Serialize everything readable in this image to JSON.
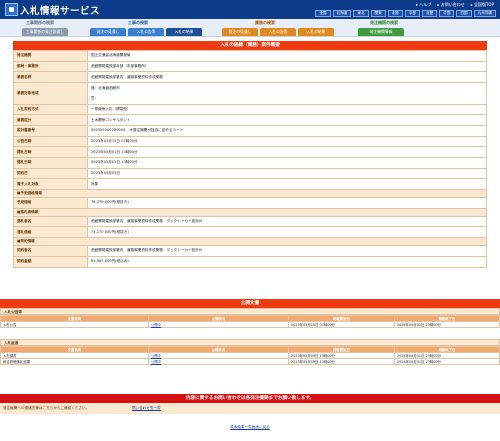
{
  "header": {
    "title": "入札情報サービス",
    "links": [
      "ヘルプ",
      "お問い合わせ",
      "全国版TOP"
    ],
    "regions": [
      "全国",
      "北海道",
      "東北",
      "関東",
      "北陸",
      "中部",
      "近畿",
      "中国",
      "四国",
      "九州沖縄"
    ]
  },
  "categories": {
    "c1": "工事関係の検索",
    "c2": "工事の検索",
    "c3": "業務の検索",
    "c4": "発注機関の検索"
  },
  "tabs": [
    {
      "label": "工事関係の発注見通し"
    },
    {
      "label": "発注の見通し"
    },
    {
      "label": "入札公告等"
    },
    {
      "label": "入札の結果"
    },
    {
      "label": "発注の見通し"
    },
    {
      "label": "入札公告等"
    },
    {
      "label": "入札の結果"
    },
    {
      "label": "発注機関情報"
    }
  ],
  "main": {
    "title": "入札の経緯（業務）案件概要",
    "rows": [
      {
        "k": "発注機関",
        "v": "国土交通省北海道開発局"
      },
      {
        "k": "部局・事務所",
        "v": "函館開発建設部本部（本部事務所）"
      },
      {
        "k": "業務名称",
        "v": "函館開発建設部管内　道路事業資料作成業務"
      },
      {
        "k": "業務対象地域",
        "v1": "渡：北海道函館市",
        "v2": "笠："
      },
      {
        "k": "入札契約方式",
        "v": "一般競争入札（標準型）"
      },
      {
        "k": "業務区分",
        "v": "土木関係コンサルタント"
      },
      {
        "k": "設計書番号",
        "v": "202325000289004",
        "note": "※発注機関が独自に定めるコード"
      },
      {
        "k": "公告日時",
        "v": "2023年03月15日 07時00分"
      },
      {
        "k": "開札日時",
        "v": "2023年05月01日 13時00分"
      },
      {
        "k": "開札日時",
        "v": "2023年05月02日 13時00分"
      },
      {
        "k": "契約日",
        "v": "2023年05月03日"
      },
      {
        "k": "電子入札対象",
        "v": "対象"
      }
    ],
    "section1": "■予定価格情報",
    "estimate": {
      "k": "予定価格",
      "v": "76,370,000円(税抜き)"
    },
    "section2": "■落札者情報",
    "winner": [
      {
        "k": "落札者名",
        "v": "函館開発建設部管内　道路事業資料作成業務　デックトーカー設計JV"
      },
      {
        "k": "落札価格",
        "v": "74,170,000円(税抜き)"
      }
    ],
    "section3": "■契約情報",
    "contract": [
      {
        "k": "契約者名",
        "v": "函館開発建設部管内　道路事業資料作成業務　デックトーカー設計JV"
      },
      {
        "k": "契約金額",
        "v": "81,587,000円(税込み)"
      }
    ]
  },
  "docs": {
    "title": "公開文書",
    "g1_title": "入札公告等",
    "headers": [
      "文書名称",
      "公開状況",
      "掲載開始日",
      "掲載終了日"
    ],
    "g1_rows": [
      {
        "name": "入札公告",
        "status": "公開中",
        "start": "2023年03月15日 07時00分",
        "end": "2024年05月31日 23時00分"
      }
    ],
    "g2_title": "入札経過",
    "g2_rows": [
      {
        "name": "入札調書",
        "status": "公開中",
        "start": "2023年05月09日 10時00分",
        "end": "2024年05月31日 23時00分"
      },
      {
        "name": "総合評価落札結果",
        "status": "公開中",
        "start": "2023年05月09日 10時00分",
        "end": "2024年05月31日 23時00分"
      }
    ]
  },
  "inquiry": {
    "title": "内容に関するお問い合わせは各発注機関までお願い致します。",
    "left": "発注機関への連絡先等はこちらからご確認ください。",
    "link": "問い合わせ先一覧",
    "back": "検索結果一覧画面に戻る"
  }
}
